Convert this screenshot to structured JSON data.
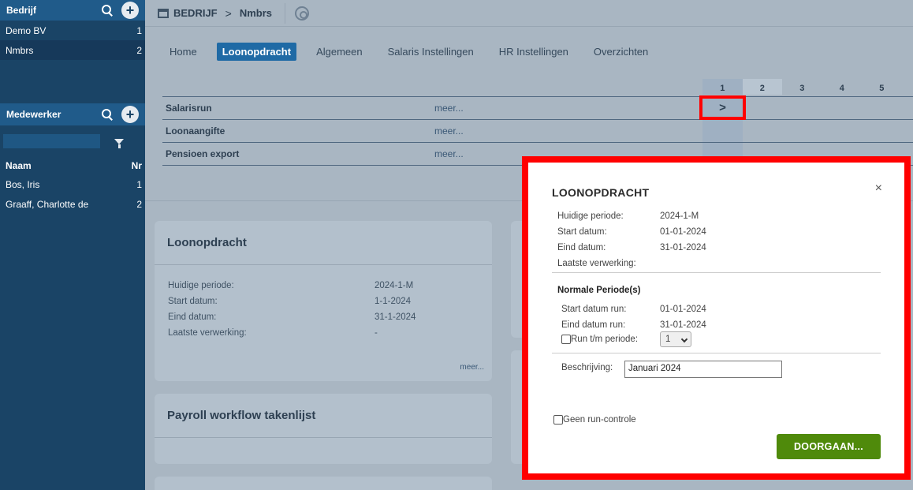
{
  "sidebar": {
    "bedrijf": {
      "title": "Bedrijf",
      "items": [
        {
          "label": "Demo BV",
          "count": "1"
        },
        {
          "label": "Nmbrs",
          "count": "2"
        }
      ]
    },
    "medewerker": {
      "title": "Medewerker",
      "filter_value": "",
      "col_name": "Naam",
      "col_nr": "Nr",
      "items": [
        {
          "label": "Bos, Iris",
          "count": "1"
        },
        {
          "label": "Graaff, Charlotte de",
          "count": "2"
        }
      ]
    }
  },
  "topbar": {
    "crumb1": "BEDRIJF",
    "sep": ">",
    "crumb2": "Nmbrs"
  },
  "tabs": [
    "Home",
    "Loonopdracht",
    "Algemeen",
    "Salaris Instellingen",
    "HR Instellingen",
    "Overzichten"
  ],
  "periods": [
    "1",
    "2",
    "3",
    "4",
    "5"
  ],
  "runs": [
    {
      "name": "Salarisrun",
      "meer": "meer..."
    },
    {
      "name": "Loonaangifte",
      "meer": "meer..."
    },
    {
      "name": "Pensioen export",
      "meer": "meer..."
    }
  ],
  "arrow": ">",
  "card_loon": {
    "title": "Loonopdracht",
    "rows": [
      {
        "k": "Huidige periode:",
        "v": "2024-1-M"
      },
      {
        "k": "Start datum:",
        "v": "1-1-2024"
      },
      {
        "k": "Eind datum:",
        "v": "31-1-2024"
      },
      {
        "k": "Laatste verwerking:",
        "v": "-"
      }
    ],
    "more": "meer..."
  },
  "card_payroll": {
    "title": "Payroll workflow takenlijst"
  },
  "modal": {
    "title": "LOONOPDRACHT",
    "close": "×",
    "rows": [
      {
        "k": "Huidige periode:",
        "v": "2024-1-M"
      },
      {
        "k": "Start datum:",
        "v": "01-01-2024"
      },
      {
        "k": "Eind datum:",
        "v": "31-01-2024"
      },
      {
        "k": "Laatste verwerking:",
        "v": ""
      }
    ],
    "normale": "Normale Periode(s)",
    "run_rows": [
      {
        "k": "Start datum run:",
        "v": "01-01-2024"
      },
      {
        "k": "Eind datum run:",
        "v": "31-01-2024"
      }
    ],
    "run_tm_label": "Run t/m periode:",
    "run_tm_value": "1",
    "beschrijving_label": "Beschrijving:",
    "beschrijving_value": "Januari 2024",
    "geen_label": "Geen run-controle",
    "button": "DOORGAAN..."
  }
}
